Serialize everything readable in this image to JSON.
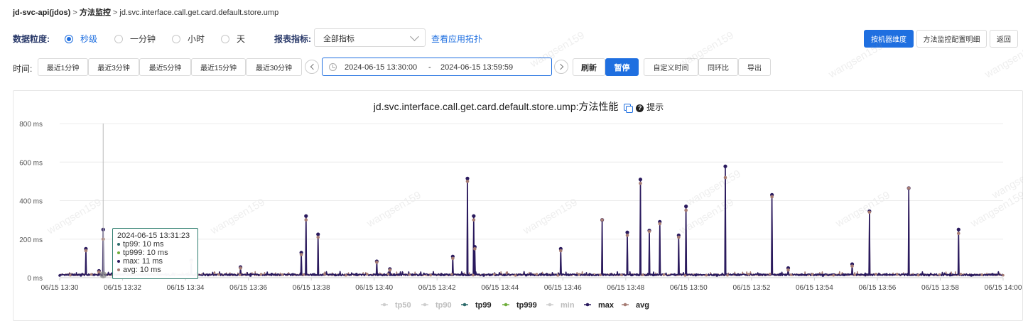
{
  "breadcrumb": {
    "app": "jd-svc-api(jdos)",
    "sep1": ">",
    "section": "方法监控",
    "sep2": ">",
    "method": "jd.svc.interface.call.get.card.default.store.ump"
  },
  "filters": {
    "granularity_label": "数据粒度:",
    "granularity_options": [
      "秒级",
      "一分钟",
      "小时",
      "天"
    ],
    "granularity_selected": "秒级",
    "metric_label": "报表指标:",
    "metric_value": "全部指标",
    "topology_link": "查看应用拓扑"
  },
  "actions": {
    "by_machine": "按机器维度",
    "config_detail": "方法监控配置明细",
    "back": "返回"
  },
  "time": {
    "label": "时间:",
    "quick": [
      "最近1分钟",
      "最近3分钟",
      "最近5分钟",
      "最近15分钟",
      "最近30分钟"
    ],
    "start": "2024-06-15 13:30:00",
    "dash": "-",
    "end": "2024-06-15 13:59:59",
    "refresh": "刷新",
    "pause": "暂停",
    "custom": "自定义时间",
    "compare": "同环比",
    "export": "导出"
  },
  "chart_title": {
    "text": "jd.svc.interface.call.get.card.default.store.ump:方法性能",
    "help": "?",
    "hint": "提示"
  },
  "tooltip": {
    "time": "2024-06-15 13:31:23",
    "rows": [
      "tp99: 10 ms",
      "tp999: 10 ms",
      "max: 11 ms",
      "avg: 10 ms"
    ]
  },
  "colors": {
    "accent": "#1f6fe0",
    "tp50": "#bdbdbd",
    "tp90": "#bdbdbd",
    "tp99": "#2e6b6b",
    "tp999": "#6fae3c",
    "min": "#c8c8c8",
    "max": "#2a1a5e",
    "avg": "#a67c74"
  },
  "watermark": "wangsen159",
  "chart_data": {
    "type": "line",
    "title": "jd.svc.interface.call.get.card.default.store.ump:方法性能",
    "ylim": [
      0,
      800
    ],
    "yticks": [
      0,
      200,
      400,
      600,
      800
    ],
    "ytick_labels": [
      "0 ms",
      "200 ms",
      "400 ms",
      "600 ms",
      "800 ms"
    ],
    "xlim": [
      "13:30:00",
      "14:00:00"
    ],
    "xtick_labels": [
      "06/15 13:30",
      "06/15 13:32",
      "06/15 13:34",
      "06/15 13:36",
      "06/15 13:38",
      "06/15 13:40",
      "06/15 13:42",
      "06/15 13:44",
      "06/15 13:46",
      "06/15 13:48",
      "06/15 13:50",
      "06/15 13:52",
      "06/15 13:54",
      "06/15 13:56",
      "06/15 13:58",
      "06/15 14:00"
    ],
    "grid": true,
    "legend_position": "bottom",
    "series": [
      {
        "name": "tp50",
        "active": false
      },
      {
        "name": "tp90",
        "active": false
      },
      {
        "name": "tp99",
        "active": true
      },
      {
        "name": "tp999",
        "active": true
      },
      {
        "name": "min",
        "active": false
      },
      {
        "name": "max",
        "active": true
      },
      {
        "name": "avg",
        "active": true
      }
    ],
    "baseline_ms": 15,
    "spikes": [
      {
        "t": "13:30:50",
        "max": 150,
        "avg": 140
      },
      {
        "t": "13:31:15",
        "max": 35,
        "avg": 30
      },
      {
        "t": "13:31:23",
        "max": 250,
        "avg": 200
      },
      {
        "t": "13:34:11",
        "max": 90,
        "avg": 80
      },
      {
        "t": "13:35:45",
        "max": 55,
        "avg": 50
      },
      {
        "t": "13:37:41",
        "max": 130,
        "avg": 120
      },
      {
        "t": "13:37:50",
        "max": 320,
        "avg": 300
      },
      {
        "t": "13:38:13",
        "max": 225,
        "avg": 210
      },
      {
        "t": "13:40:05",
        "max": 85,
        "avg": 80
      },
      {
        "t": "13:40:30",
        "max": 45,
        "avg": 40
      },
      {
        "t": "13:42:30",
        "max": 110,
        "avg": 100
      },
      {
        "t": "13:42:58",
        "max": 515,
        "avg": 500
      },
      {
        "t": "13:43:10",
        "max": 320,
        "avg": 300
      },
      {
        "t": "13:43:12",
        "max": 160,
        "avg": 150
      },
      {
        "t": "13:45:56",
        "max": 150,
        "avg": 140
      },
      {
        "t": "13:47:15",
        "max": 300,
        "avg": 300
      },
      {
        "t": "13:48:03",
        "max": 235,
        "avg": 220
      },
      {
        "t": "13:48:28",
        "max": 510,
        "avg": 490
      },
      {
        "t": "13:48:45",
        "max": 245,
        "avg": 240
      },
      {
        "t": "13:49:05",
        "max": 290,
        "avg": 280
      },
      {
        "t": "13:49:41",
        "max": 220,
        "avg": 210
      },
      {
        "t": "13:49:55",
        "max": 370,
        "avg": 350
      },
      {
        "t": "13:51:10",
        "max": 578,
        "avg": 520
      },
      {
        "t": "13:52:39",
        "max": 430,
        "avg": 420
      },
      {
        "t": "13:53:10",
        "max": 50,
        "avg": 40
      },
      {
        "t": "13:55:12",
        "max": 70,
        "avg": 60
      },
      {
        "t": "13:55:45",
        "max": 345,
        "avg": 340
      },
      {
        "t": "13:57:00",
        "max": 465,
        "avg": 465
      },
      {
        "t": "13:58:35",
        "max": 250,
        "avg": 230
      }
    ]
  }
}
